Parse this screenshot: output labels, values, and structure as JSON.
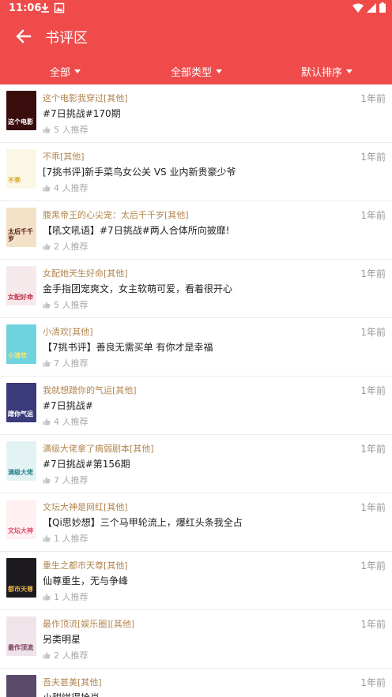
{
  "status": {
    "time": "11:06"
  },
  "header": {
    "title": "书评区"
  },
  "filters": [
    {
      "label": "全部"
    },
    {
      "label": "全部类型"
    },
    {
      "label": "默认排序"
    }
  ],
  "colors": {
    "accent": "#ef4b4b",
    "book_title": "#b2864e"
  },
  "reviews": [
    {
      "book": "这个电影我穿过[其他]",
      "text": "#7日挑战#170期",
      "likes": "5 人推荐",
      "time": "1年前",
      "cover_text": "这个电影",
      "cover_bg": "#3a0d0d",
      "cover_fg": "#ffffff"
    },
    {
      "book": "不乖[其他]",
      "text": "[7挑书评]新手菜鸟女公关 VS 业内新贵豪少爷",
      "likes": "4 人推荐",
      "time": "1年前",
      "cover_text": "不乖",
      "cover_bg": "#fbf7e6",
      "cover_fg": "#d8a62a"
    },
    {
      "book": "腹黑帝王的心尖宠：太后千千岁[其他]",
      "text": "【吼文吼语】#7日挑战#两人合体所向披靡!",
      "likes": "2 人推荐",
      "time": "1年前",
      "cover_text": "太后千千岁",
      "cover_bg": "#f3e2c8",
      "cover_fg": "#5a1a12"
    },
    {
      "book": "女配她天生好命[其他]",
      "text": "金手指团宠爽文，女主软萌可爱，看着很开心",
      "likes": "5 人推荐",
      "time": "1年前",
      "cover_text": "女配好命",
      "cover_bg": "#f6e9ec",
      "cover_fg": "#c0334a"
    },
    {
      "book": "小清欢[其他]",
      "text": "【7挑书评】善良无需买单 有你才是幸福",
      "likes": "7 人推荐",
      "time": "1年前",
      "cover_text": "小清欢",
      "cover_bg": "#6fd3df",
      "cover_fg": "#ffe566"
    },
    {
      "book": "我就想蹭你的气运[其他]",
      "text": "#7日挑战#",
      "likes": "4 人推荐",
      "time": "1年前",
      "cover_text": "蹭你气运",
      "cover_bg": "#3b3a7a",
      "cover_fg": "#ffffff"
    },
    {
      "book": "满级大佬拿了病弱剧本[其他]",
      "text": "#7日挑战#第156期",
      "likes": "7 人推荐",
      "time": "1年前",
      "cover_text": "满级大佬",
      "cover_bg": "#e3f3f3",
      "cover_fg": "#2a7f8a"
    },
    {
      "book": "文坛大神是网红[其他]",
      "text": "【Qi思妙想】三个马甲轮流上，爆红头条我全占",
      "likes": "1 人推荐",
      "time": "1年前",
      "cover_text": "文坛大神",
      "cover_bg": "#fff0f2",
      "cover_fg": "#e24a6a"
    },
    {
      "book": "重生之都市天尊[其他]",
      "text": "仙尊重生，无与争峰",
      "likes": "1 人推荐",
      "time": "1年前",
      "cover_text": "都市天尊",
      "cover_bg": "#1d1a1f",
      "cover_fg": "#e6b24a"
    },
    {
      "book": "最作顶流[娱乐圈][其他]",
      "text": "另类明星",
      "likes": "2 人推荐",
      "time": "1年前",
      "cover_text": "最作顶流",
      "cover_bg": "#efe4ea",
      "cover_fg": "#7a3a5a"
    },
    {
      "book": "吾夫甚美[其他]",
      "text": "小甜饼得拾肖",
      "likes": "",
      "time": "1年前",
      "cover_text": "",
      "cover_bg": "#5a4a6a",
      "cover_fg": "#ffffff"
    }
  ]
}
